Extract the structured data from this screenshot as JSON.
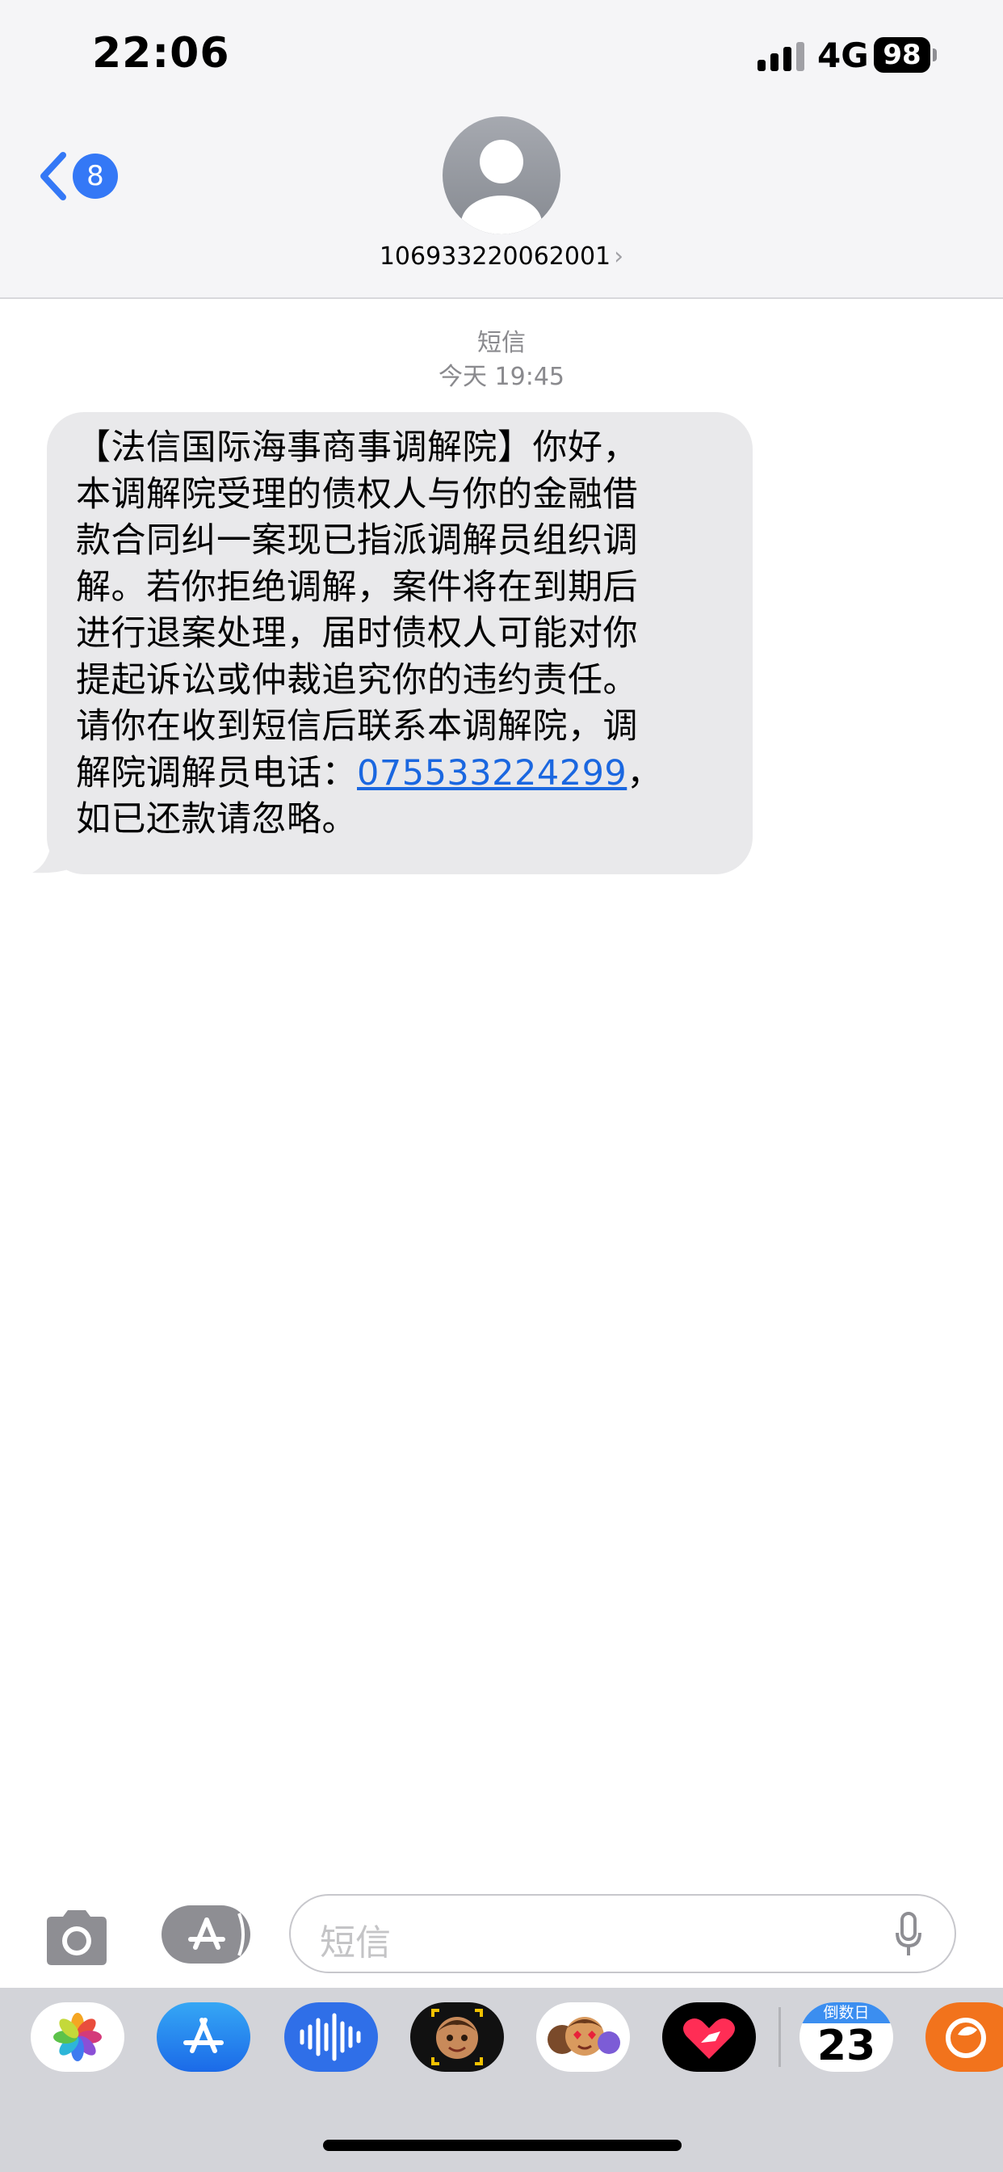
{
  "status_bar": {
    "time": "22:06",
    "network": "4G",
    "battery": "98",
    "icons": [
      "signal-icon",
      "battery-icon"
    ]
  },
  "nav": {
    "back_count": "8",
    "contact_number": "106933220062001",
    "icons": [
      "back-chevron-icon",
      "avatar-icon",
      "chevron-right-icon"
    ]
  },
  "thread": {
    "service": "短信",
    "timestamp": "今天 19:45",
    "message": {
      "lines": [
        "【法信国际海事商事调解院】你好，",
        "本调解院受理的债权人与你的金融借",
        "款合同纠一案现已指派调解员组织调",
        "解。若你拒绝调解，案件将在到期后",
        "进行退案处理，届时债权人可能对你",
        "提起诉讼或仲裁追究你的违约责任。",
        "请你在收到短信后联系本调解院，调"
      ],
      "line8_prefix": "解院调解员电话：",
      "phone": "075533224299",
      "line8_suffix": "，",
      "last_line": "如已还款请忽略。"
    }
  },
  "input_bar": {
    "placeholder": "短信",
    "icons": [
      "camera-icon",
      "app-store-icon",
      "mic-icon"
    ]
  },
  "app_drawer": {
    "apps": [
      "photos-app-icon",
      "app-store-app-icon",
      "audio-message-icon",
      "memoji-icon",
      "memoji-stickers-icon",
      "digital-touch-icon",
      "countdown-app-icon",
      "squirrel-app-icon"
    ],
    "countdown_header": "倒数日",
    "countdown_value": "23"
  },
  "colors": {
    "accent_blue": "#3478f6",
    "link_blue": "#1a67e0",
    "bubble_gray": "#e9e9eb",
    "header_bg": "#f5f5f7",
    "drawer_bg": "#d3d4d9"
  }
}
